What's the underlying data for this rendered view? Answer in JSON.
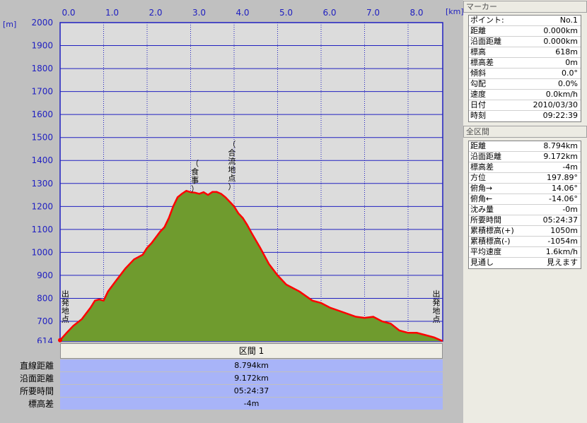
{
  "chart_data": {
    "type": "area",
    "title": "",
    "xlabel": "[km]",
    "ylabel": "[m]",
    "xlim": [
      0,
      8.794
    ],
    "ylim": [
      614,
      2000
    ],
    "x_ticks": [
      "0.0",
      "1.0",
      "2.0",
      "3.0",
      "4.0",
      "5.0",
      "6.0",
      "7.0",
      "8.0"
    ],
    "y_ticks": [
      "2000",
      "1900",
      "1800",
      "1700",
      "1600",
      "1500",
      "1400",
      "1300",
      "1200",
      "1100",
      "1000",
      "900",
      "800",
      "700",
      "614"
    ],
    "colors": {
      "fill": "#6f9b2e",
      "line": "#ff0000",
      "plot_bg": "#dcdcdc",
      "grid": "#2020c0"
    },
    "series": [
      {
        "x": [
          0.0,
          0.15,
          0.3,
          0.5,
          0.7,
          0.8,
          0.9,
          1.0,
          1.1,
          1.3,
          1.5,
          1.7,
          1.9,
          2.0,
          2.1,
          2.3,
          2.4,
          2.5,
          2.6,
          2.7,
          2.8,
          2.9,
          3.0,
          3.1,
          3.2,
          3.3,
          3.4,
          3.5,
          3.6,
          3.7,
          3.8,
          3.9,
          4.0,
          4.1,
          4.2,
          4.3,
          4.4,
          4.6,
          4.8,
          5.0,
          5.2,
          5.5,
          5.8,
          6.0,
          6.2,
          6.5,
          6.8,
          7.0,
          7.2,
          7.4,
          7.6,
          7.8,
          8.0,
          8.2,
          8.4,
          8.6,
          8.794
        ],
        "y": [
          618,
          650,
          680,
          710,
          760,
          790,
          795,
          790,
          830,
          880,
          930,
          970,
          990,
          1020,
          1040,
          1090,
          1110,
          1150,
          1200,
          1240,
          1255,
          1268,
          1262,
          1260,
          1255,
          1262,
          1250,
          1263,
          1263,
          1255,
          1240,
          1220,
          1200,
          1170,
          1150,
          1120,
          1085,
          1020,
          950,
          900,
          860,
          830,
          790,
          780,
          760,
          740,
          720,
          715,
          720,
          700,
          690,
          660,
          650,
          650,
          640,
          630,
          614
        ]
      }
    ],
    "annotations": [
      {
        "text": "出発地点",
        "x": 0.12,
        "y": 770
      },
      {
        "text": "（食事）",
        "x": 3.1,
        "y": 1340
      },
      {
        "text": "（合流地点）",
        "x": 3.95,
        "y": 1385
      },
      {
        "text": "出発地点",
        "x": 8.65,
        "y": 770
      }
    ]
  },
  "section": {
    "label": "区間 1",
    "stats": [
      {
        "label": "直線距離",
        "value": "8.794km"
      },
      {
        "label": "沿面距離",
        "value": "9.172km"
      },
      {
        "label": "所要時間",
        "value": "05:24:37"
      },
      {
        "label": "標高差",
        "value": "-4m"
      }
    ]
  },
  "marker_panel": {
    "title": "マーカー",
    "rows": [
      {
        "label": "ポイント:",
        "value": "No.1"
      },
      {
        "label": "距離",
        "value": "0.000km"
      },
      {
        "label": "沿面距離",
        "value": "0.000km"
      },
      {
        "label": "標高",
        "value": "618m"
      },
      {
        "label": "標高差",
        "value": "0m"
      },
      {
        "label": "傾斜",
        "value": "0.0°"
      },
      {
        "label": "勾配",
        "value": "0.0%"
      },
      {
        "label": "速度",
        "value": "0.0km/h"
      },
      {
        "label": "日付",
        "value": "2010/03/30"
      },
      {
        "label": "時刻",
        "value": "09:22:39"
      }
    ]
  },
  "all_section_panel": {
    "title": "全区間",
    "rows": [
      {
        "label": "距離",
        "value": "8.794km"
      },
      {
        "label": "沿面距離",
        "value": "9.172km"
      },
      {
        "label": "標高差",
        "value": "-4m"
      },
      {
        "label": "方位",
        "value": "197.89°"
      },
      {
        "label": "俯角→",
        "value": "14.06°"
      },
      {
        "label": "俯角←",
        "value": "-14.06°"
      },
      {
        "label": "沈み量",
        "value": "-0m"
      },
      {
        "label": "所要時間",
        "value": "05:24:37"
      },
      {
        "label": "累積標高(+)",
        "value": "1050m"
      },
      {
        "label": "累積標高(-)",
        "value": "-1054m"
      },
      {
        "label": "平均速度",
        "value": "1.6km/h"
      },
      {
        "label": "見通し",
        "value": "見えます"
      }
    ]
  }
}
